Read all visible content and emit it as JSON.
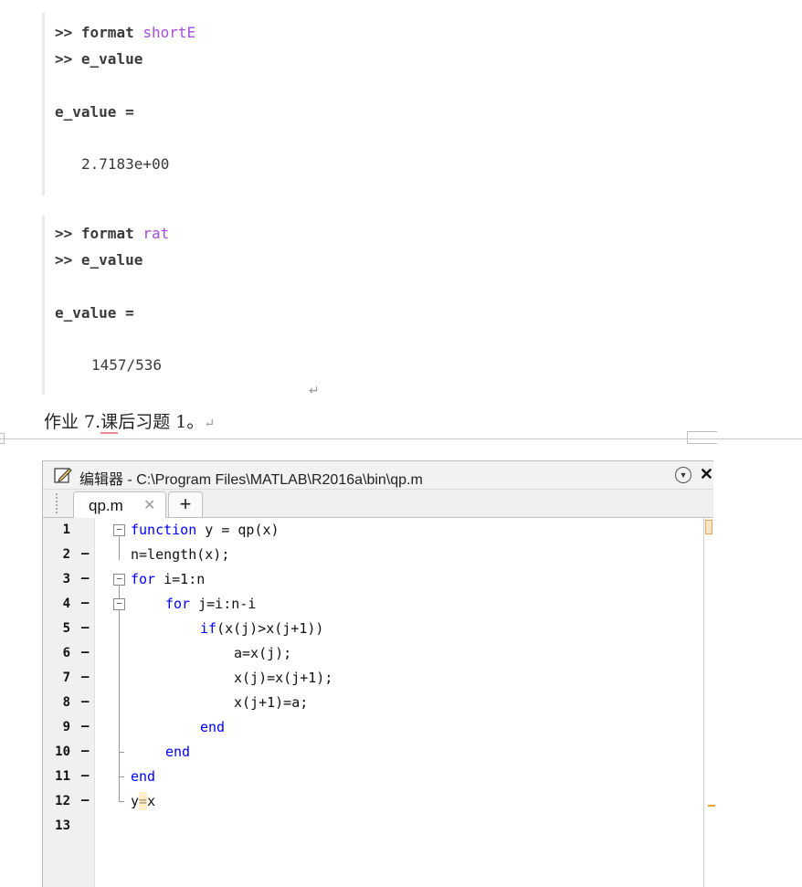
{
  "console1": {
    "line1": {
      "prompt": ">>",
      "cmd": "format",
      "arg": "shortE"
    },
    "line2": {
      "prompt": ">>",
      "cmd": "e_value"
    },
    "result_label": "e_value =",
    "result_value": "2.7183e+00"
  },
  "console2": {
    "line1": {
      "prompt": ">>",
      "cmd": "format",
      "arg": "rat"
    },
    "line2": {
      "prompt": ">>",
      "cmd": "e_value"
    },
    "result_label": "e_value =",
    "result_value": "1457/536"
  },
  "doc": {
    "prefix": "作业 7.",
    "underlined": "课",
    "suffix": "后习题 1。",
    "return_mark": "↵"
  },
  "editor": {
    "title": "编辑器 - C:\\Program Files\\MATLAB\\R2016a\\bin\\qp.m",
    "tab_label": "qp.m",
    "tab_close": "✕",
    "add_tab": "+",
    "menu_icon": "▼",
    "close_icon": "✕",
    "lines": [
      {
        "num": "1",
        "dash": "",
        "kw": "function",
        "text": " y = qp(x)"
      },
      {
        "num": "2",
        "dash": "–",
        "kw": "",
        "text": "n=length(x);"
      },
      {
        "num": "3",
        "dash": "–",
        "kw": "for",
        "text": " i=1:n"
      },
      {
        "num": "4",
        "dash": "–",
        "kw": "for",
        "text": " j=i:n-i"
      },
      {
        "num": "5",
        "dash": "–",
        "kw": "if",
        "text": "(x(j)>x(j+1))"
      },
      {
        "num": "6",
        "dash": "–",
        "kw": "",
        "text": "a=x(j);"
      },
      {
        "num": "7",
        "dash": "–",
        "kw": "",
        "text": "x(j)=x(j+1);"
      },
      {
        "num": "8",
        "dash": "–",
        "kw": "",
        "text": "x(j+1)=a;"
      },
      {
        "num": "9",
        "dash": "–",
        "kw": "end",
        "text": ""
      },
      {
        "num": "10",
        "dash": "–",
        "kw": "end",
        "text": ""
      },
      {
        "num": "11",
        "dash": "–",
        "kw": "end",
        "text": ""
      },
      {
        "num": "12",
        "dash": "–",
        "kw": "",
        "text": "y=x"
      },
      {
        "num": "13",
        "dash": "",
        "kw": "",
        "text": ""
      }
    ]
  },
  "colors": {
    "keyword": "#0000ff",
    "format_arg": "#a34fd9",
    "highlight": "#ffe3a6"
  }
}
